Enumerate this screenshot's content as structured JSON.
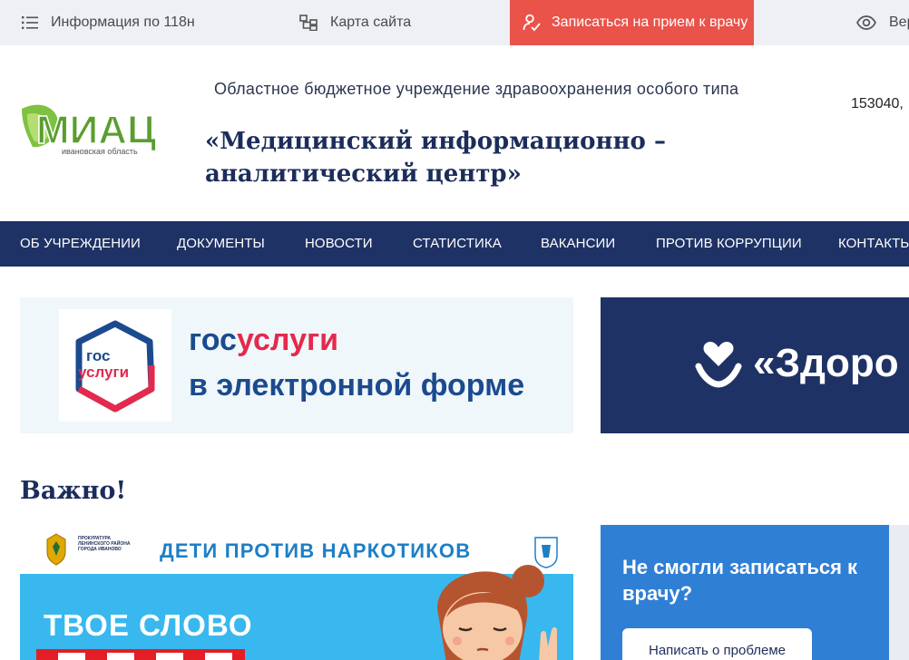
{
  "topbar": {
    "info_label": "Информация по 118н",
    "sitemap_label": "Карта сайта",
    "appointment_label": "Записаться на прием к врачу",
    "vision_label": "Вер"
  },
  "header": {
    "logo_text": "МИАЦ",
    "logo_subtitle": "ивановская область",
    "org_type": "Областное бюджетное учреждение здравоохранения особого типа",
    "org_name": "«Медицинский информационно – аналитический центр»",
    "address": "153040,"
  },
  "nav": {
    "items": [
      "ОБ УЧРЕЖДЕНИИ",
      "ДОКУМЕНТЫ",
      "НОВОСТИ",
      "СТАТИСТИКА",
      "ВАКАНСИИ",
      "ПРОТИВ КОРРУПЦИИ",
      "КОНТАКТЫ"
    ]
  },
  "banners": {
    "gos_logo_line1": "гос",
    "gos_logo_line2": "услуги",
    "gos_title_blue": "гос",
    "gos_title_red": "услуги",
    "gos_subtitle": "в электронной форме",
    "zdorovie_text": "«Здоро"
  },
  "important": {
    "heading": "Важно!"
  },
  "poster": {
    "org_text": "ПРОКУРАТУРА ЛЕНИНСКОГО РАЙОНА ГОРОДА ИВАНОВО",
    "title": "ДЕТИ ПРОТИВ НАРКОТИКОВ",
    "slogan": "ТВОЕ СЛОВО"
  },
  "card": {
    "title": "Не смогли записаться к врачу?",
    "button_label": "Написать о проблеме"
  },
  "colors": {
    "navy": "#1f3265",
    "accent_red": "#e9534a",
    "topbar_bg": "#eef0f6",
    "card_blue": "#2f7fd5"
  }
}
